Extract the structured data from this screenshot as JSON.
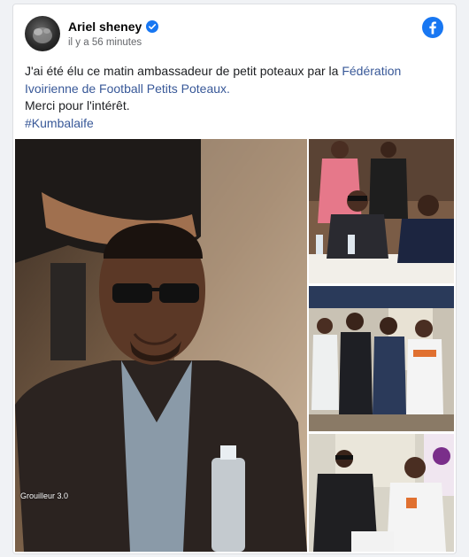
{
  "post": {
    "author": "Ariel sheney",
    "timestamp": "il y a 56 minutes",
    "text_line1_a": "J'ai été élu ce matin ambassadeur de petit poteaux par la ",
    "text_line1_link": "Fédération Ivoirienne de Football Petits Poteaux.",
    "text_line2": "Merci pour l'intérêt.",
    "hashtag": "#Kumbalaife"
  },
  "photos": {
    "watermark": "Grouilleur 3.0"
  },
  "colors": {
    "facebook_blue": "#1877f2",
    "link": "#385898",
    "verified": "#1877f2"
  },
  "icons": {
    "verified": "verified-badge-icon",
    "brand": "facebook-logo-icon"
  }
}
